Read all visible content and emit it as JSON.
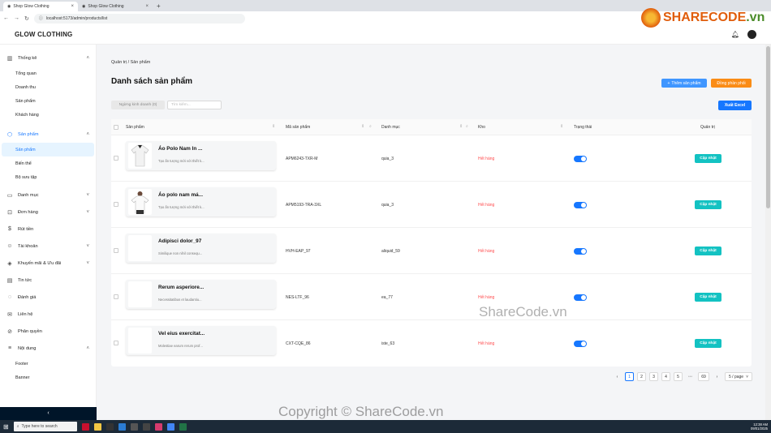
{
  "browser": {
    "tabs": [
      {
        "label": "Shop Glow Clothing",
        "active": true
      },
      {
        "label": "Shop Glow Clothing",
        "active": false
      }
    ],
    "url": "localhost:5173/admin/products/list"
  },
  "header": {
    "brand": "GLOW CLOTHING"
  },
  "sidebar": {
    "groups": [
      {
        "label": "Thống kê",
        "icon": "chart-icon",
        "children": [
          "Tổng quan",
          "Doanh thu",
          "Sản phẩm",
          "Khách hàng"
        ]
      },
      {
        "label": "Sản phẩm",
        "icon": "box-icon",
        "children": [
          "Sản phẩm",
          "Biến thể",
          "Bộ sưu tập"
        ]
      },
      {
        "label": "Danh mục",
        "icon": "folder-icon"
      },
      {
        "label": "Đơn hàng",
        "icon": "cart-icon"
      },
      {
        "label": "Rút tiền",
        "icon": "dollar-icon"
      },
      {
        "label": "Tài khoản",
        "icon": "user-icon"
      },
      {
        "label": "Khuyến mãi & Ưu đãi",
        "icon": "tag-icon"
      },
      {
        "label": "Tin tức",
        "icon": "news-icon"
      },
      {
        "label": "Đánh giá",
        "icon": "chat-icon"
      },
      {
        "label": "Liên hệ",
        "icon": "mail-icon"
      },
      {
        "label": "Phân quyền",
        "icon": "lock-icon"
      },
      {
        "label": "Nội dung",
        "icon": "menu-icon",
        "children": [
          "Footer",
          "Banner"
        ]
      }
    ],
    "collapse": "‹"
  },
  "main": {
    "breadcrumb": "Quản trị / Sản phẩm",
    "title": "Danh sách sản phẩm",
    "add_button": "Thêm sản phẩm",
    "sync_button": "Đồng phần phối",
    "filter_button": "Ngừng kinh doanh (0)",
    "search_placeholder": "Tìm kiếm...",
    "export_button": "Xuất Excel",
    "columns": [
      "Sản phẩm",
      "Mã sản phẩm",
      "Danh mục",
      "Kho",
      "Trạng thái",
      "Quản trị"
    ],
    "rows": [
      {
        "name": "Áo Polo Nam In ...",
        "desc": "Tạo ấn tượng mới với thiết k...",
        "sku": "APM6243-TXR-M",
        "category": "quia_3",
        "stock": "Hết hàng",
        "update": "Cập nhật",
        "has_image": true
      },
      {
        "name": "Áo polo nam má...",
        "desc": "Tạo ấn tượng mới với thiết k...",
        "sku": "APM5193-TRA-3XL",
        "category": "quia_3",
        "stock": "Hết hàng",
        "update": "Cập nhật",
        "has_image": true
      },
      {
        "name": "Adipisci dolor_97",
        "desc": "Similique non nihil consequ...",
        "sku": "HVH-EAP_97",
        "category": "aliquid_59",
        "stock": "Hết hàng",
        "update": "Cập nhật",
        "has_image": false
      },
      {
        "name": "Rerum asperiore...",
        "desc": "Necessitatibus et laudantiu...",
        "sku": "NES-LTF_96",
        "category": "ea_77",
        "stock": "Hết hàng",
        "update": "Cập nhật",
        "has_image": false
      },
      {
        "name": "Vel eius exercitat...",
        "desc": "Molestiae earum rerum prof...",
        "sku": "CXT-CQE_86",
        "category": "iste_63",
        "stock": "Hết hàng",
        "update": "Cập nhật",
        "has_image": false
      }
    ],
    "pagination": {
      "pages": [
        "1",
        "2",
        "3",
        "4",
        "5"
      ],
      "ellipsis": "•••",
      "last": "69",
      "current": "1",
      "page_size": "5 / page"
    }
  },
  "taskbar": {
    "search": "Type here to search",
    "time": "12:38 AM",
    "date": "09/01/2025"
  },
  "watermarks": {
    "logo_text": "SHARECODE",
    "logo_suffix": ".vn",
    "center": "ShareCode.vn",
    "bottom": "Copyright © ShareCode.vn"
  },
  "colors": {
    "primary": "#1677ff",
    "orange": "#fa8c16",
    "teal": "#13c2c2",
    "danger": "#ff4d4f"
  }
}
